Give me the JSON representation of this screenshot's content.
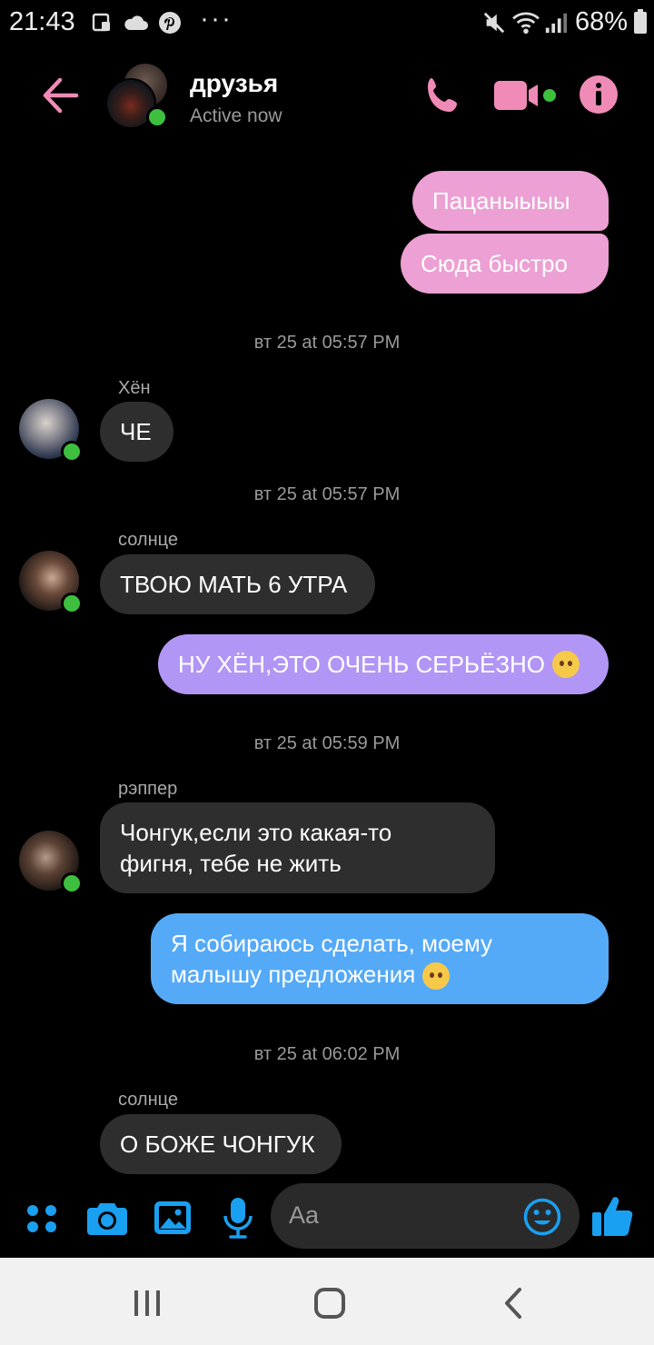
{
  "status_bar": {
    "time": "21:43",
    "more": "···",
    "battery": "68%"
  },
  "header": {
    "title": "друзья",
    "subtitle": "Active now"
  },
  "colors": {
    "accent": "#f08bb7",
    "bubble_pink": "#eca0d4",
    "bubble_violet": "#b296f6",
    "bubble_blue": "#55aaf7",
    "bubble_incoming": "#2e2e2e",
    "composer_icon": "#1aa0f0"
  },
  "messages": {
    "m1": "Пацаныыыы",
    "m2": "Сюда быстро",
    "ts1": "вт 25 at 05:57 PM",
    "s1": "Хён",
    "m3": "ЧЕ",
    "ts2": "вт 25 at 05:57 PM",
    "s2": "солнце",
    "m4": "ТВОЮ МАТЬ 6 УТРА",
    "m5": "НУ ХЁН,ЭТО ОЧЕНЬ СЕРЬЁЗНО",
    "ts3": "вт 25 at 05:59 PM",
    "s3": "рэппер",
    "m6_line1": "Чонгук,если это какая-то",
    "m6_line2": "фигня, тебе не жить",
    "m7_line1": "Я собираюсь сделать, моему",
    "m7_line2": "малышу предложения",
    "ts4": "вт 25 at 06:02 PM",
    "s4": "солнце",
    "m8": "О БОЖЕ ЧОНГУК"
  },
  "composer": {
    "placeholder": "Aa"
  },
  "icons": [
    "back-arrow-icon",
    "phone-icon",
    "video-icon",
    "info-icon",
    "menu-dots-icon",
    "camera-icon",
    "gallery-icon",
    "microphone-icon",
    "emoji-icon",
    "thumbs-up-icon",
    "nav-recents-icon",
    "nav-home-icon",
    "nav-back-icon"
  ]
}
